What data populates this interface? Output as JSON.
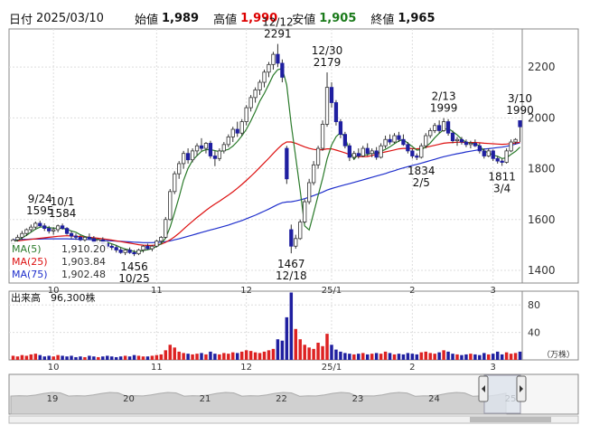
{
  "header": {
    "date_label": "日付",
    "date_value": "2025/03/10",
    "open_label": "始値",
    "open_value": "1,989",
    "high_label": "高値",
    "high_value": "1,990",
    "low_label": "安値",
    "low_value": "1,905",
    "close_label": "終値",
    "close_value": "1,965"
  },
  "colors": {
    "up": "#cc1111",
    "down": "#1f1fa0",
    "ma5": "#2a7a2a",
    "ma25": "#dd1111",
    "ma75": "#1f2fcc",
    "volume_up": "#dd2222",
    "volume_down": "#1f1fa0",
    "high_value": "#dd0000",
    "low_value": "#1a7a1a"
  },
  "legend": [
    {
      "label": "MA(5)",
      "value": "1,910.20",
      "color": "#2a7a2a"
    },
    {
      "label": "MA(25)",
      "value": "1,903.84",
      "color": "#dd1111"
    },
    {
      "label": "MA(75)",
      "value": "1,902.48",
      "color": "#1f2fcc"
    }
  ],
  "volume_panel": {
    "label": "出来高",
    "value": "96,300株",
    "unit": "（万株）",
    "yticks": [
      "80",
      "40"
    ]
  },
  "navigator": {
    "labels": [
      "19",
      "20",
      "21",
      "22",
      "23",
      "24",
      "25"
    ]
  },
  "chart_data": {
    "type": "candlestick",
    "title": "",
    "price_axis": {
      "ticks": [
        1400,
        1600,
        1800,
        2000,
        2200
      ],
      "range": [
        1350,
        2350
      ]
    },
    "volume_axis": {
      "ticks": [
        40,
        80
      ],
      "range": [
        0,
        100
      ],
      "unit": "万株"
    },
    "x_ticks": [
      {
        "label": "10",
        "index": 9
      },
      {
        "label": "11",
        "index": 32
      },
      {
        "label": "12",
        "index": 52
      },
      {
        "label": "25/1",
        "index": 71
      },
      {
        "label": "2",
        "index": 89
      },
      {
        "label": "3",
        "index": 107
      }
    ],
    "annotations": [
      {
        "text": "9/24",
        "sub": "1595",
        "index": 6,
        "price": 1595,
        "position": "above"
      },
      {
        "text": "10/1",
        "sub": "1584",
        "index": 11,
        "price": 1584,
        "position": "above"
      },
      {
        "text": "1456",
        "sub": "10/25",
        "index": 27,
        "price": 1456,
        "position": "below"
      },
      {
        "text": "12/12",
        "sub": "2291",
        "index": 59,
        "price": 2291,
        "position": "above"
      },
      {
        "text": "1467",
        "sub": "12/18",
        "index": 62,
        "price": 1467,
        "position": "below"
      },
      {
        "text": "12/30",
        "sub": "2179",
        "index": 70,
        "price": 2179,
        "position": "above"
      },
      {
        "text": "1834",
        "sub": "2/5",
        "index": 91,
        "price": 1834,
        "position": "below"
      },
      {
        "text": "2/13",
        "sub": "1999",
        "index": 96,
        "price": 1999,
        "position": "above"
      },
      {
        "text": "1811",
        "sub": "3/4",
        "index": 109,
        "price": 1811,
        "position": "below"
      },
      {
        "text": "3/10",
        "sub": "1990",
        "index": 113,
        "price": 1990,
        "position": "above"
      }
    ],
    "ohlc": [
      [
        1505,
        1525,
        1495,
        1520
      ],
      [
        1520,
        1540,
        1510,
        1530
      ],
      [
        1530,
        1555,
        1520,
        1545
      ],
      [
        1545,
        1565,
        1535,
        1560
      ],
      [
        1560,
        1580,
        1550,
        1570
      ],
      [
        1570,
        1592,
        1560,
        1585
      ],
      [
        1585,
        1595,
        1570,
        1575
      ],
      [
        1575,
        1585,
        1555,
        1565
      ],
      [
        1565,
        1575,
        1545,
        1555
      ],
      [
        1555,
        1570,
        1540,
        1560
      ],
      [
        1560,
        1580,
        1550,
        1575
      ],
      [
        1575,
        1584,
        1560,
        1565
      ],
      [
        1565,
        1570,
        1540,
        1545
      ],
      [
        1545,
        1555,
        1525,
        1535
      ],
      [
        1535,
        1545,
        1520,
        1530
      ],
      [
        1530,
        1540,
        1515,
        1520
      ],
      [
        1520,
        1535,
        1510,
        1530
      ],
      [
        1530,
        1545,
        1520,
        1525
      ],
      [
        1525,
        1535,
        1505,
        1510
      ],
      [
        1510,
        1525,
        1500,
        1520
      ],
      [
        1520,
        1530,
        1500,
        1505
      ],
      [
        1505,
        1515,
        1485,
        1495
      ],
      [
        1495,
        1505,
        1480,
        1490
      ],
      [
        1490,
        1500,
        1470,
        1480
      ],
      [
        1480,
        1490,
        1465,
        1470
      ],
      [
        1470,
        1485,
        1460,
        1480
      ],
      [
        1480,
        1490,
        1465,
        1470
      ],
      [
        1470,
        1480,
        1456,
        1465
      ],
      [
        1465,
        1485,
        1460,
        1480
      ],
      [
        1480,
        1500,
        1470,
        1495
      ],
      [
        1495,
        1505,
        1480,
        1485
      ],
      [
        1485,
        1500,
        1475,
        1495
      ],
      [
        1495,
        1520,
        1490,
        1515
      ],
      [
        1515,
        1535,
        1505,
        1530
      ],
      [
        1530,
        1610,
        1525,
        1600
      ],
      [
        1600,
        1720,
        1595,
        1710
      ],
      [
        1710,
        1790,
        1700,
        1780
      ],
      [
        1780,
        1830,
        1760,
        1820
      ],
      [
        1820,
        1870,
        1800,
        1860
      ],
      [
        1860,
        1880,
        1820,
        1835
      ],
      [
        1835,
        1880,
        1825,
        1870
      ],
      [
        1870,
        1900,
        1850,
        1890
      ],
      [
        1890,
        1920,
        1870,
        1880
      ],
      [
        1880,
        1905,
        1860,
        1900
      ],
      [
        1900,
        1910,
        1840,
        1850
      ],
      [
        1850,
        1870,
        1810,
        1840
      ],
      [
        1840,
        1880,
        1830,
        1870
      ],
      [
        1870,
        1905,
        1860,
        1895
      ],
      [
        1895,
        1935,
        1885,
        1925
      ],
      [
        1925,
        1965,
        1905,
        1955
      ],
      [
        1955,
        1985,
        1925,
        1940
      ],
      [
        1940,
        1995,
        1930,
        1985
      ],
      [
        1985,
        2050,
        1970,
        2040
      ],
      [
        2040,
        2090,
        2025,
        2080
      ],
      [
        2080,
        2120,
        2060,
        2110
      ],
      [
        2110,
        2150,
        2090,
        2140
      ],
      [
        2140,
        2190,
        2120,
        2180
      ],
      [
        2180,
        2220,
        2160,
        2210
      ],
      [
        2210,
        2260,
        2190,
        2250
      ],
      [
        2250,
        2291,
        2200,
        2215
      ],
      [
        2215,
        2230,
        2140,
        2160
      ],
      [
        1880,
        1890,
        1740,
        1760
      ],
      [
        1560,
        1580,
        1467,
        1495
      ],
      [
        1495,
        1540,
        1485,
        1525
      ],
      [
        1525,
        1600,
        1520,
        1590
      ],
      [
        1590,
        1680,
        1585,
        1670
      ],
      [
        1670,
        1760,
        1660,
        1745
      ],
      [
        1745,
        1830,
        1735,
        1815
      ],
      [
        1815,
        1890,
        1800,
        1880
      ],
      [
        1880,
        1990,
        1870,
        1975
      ],
      [
        1975,
        2179,
        1965,
        2120
      ],
      [
        2120,
        2140,
        2040,
        2060
      ],
      [
        2060,
        2070,
        1970,
        1985
      ],
      [
        1985,
        1995,
        1920,
        1935
      ],
      [
        1935,
        1945,
        1880,
        1890
      ],
      [
        1890,
        1900,
        1830,
        1845
      ],
      [
        1845,
        1870,
        1835,
        1860
      ],
      [
        1860,
        1880,
        1840,
        1850
      ],
      [
        1850,
        1890,
        1845,
        1880
      ],
      [
        1880,
        1900,
        1850,
        1860
      ],
      [
        1860,
        1880,
        1845,
        1870
      ],
      [
        1870,
        1885,
        1835,
        1845
      ],
      [
        1845,
        1900,
        1840,
        1890
      ],
      [
        1890,
        1930,
        1880,
        1915
      ],
      [
        1915,
        1935,
        1895,
        1905
      ],
      [
        1905,
        1940,
        1900,
        1930
      ],
      [
        1930,
        1945,
        1905,
        1915
      ],
      [
        1915,
        1935,
        1890,
        1895
      ],
      [
        1895,
        1905,
        1860,
        1870
      ],
      [
        1870,
        1880,
        1840,
        1850
      ],
      [
        1850,
        1860,
        1834,
        1845
      ],
      [
        1845,
        1900,
        1840,
        1890
      ],
      [
        1890,
        1940,
        1880,
        1930
      ],
      [
        1930,
        1960,
        1920,
        1950
      ],
      [
        1950,
        1980,
        1940,
        1970
      ],
      [
        1970,
        1990,
        1940,
        1950
      ],
      [
        1950,
        1999,
        1945,
        1985
      ],
      [
        1985,
        1995,
        1930,
        1940
      ],
      [
        1940,
        1950,
        1900,
        1910
      ],
      [
        1910,
        1925,
        1890,
        1915
      ],
      [
        1915,
        1925,
        1895,
        1905
      ],
      [
        1905,
        1915,
        1885,
        1895
      ],
      [
        1895,
        1910,
        1880,
        1900
      ],
      [
        1900,
        1915,
        1885,
        1890
      ],
      [
        1890,
        1900,
        1860,
        1870
      ],
      [
        1870,
        1880,
        1840,
        1850
      ],
      [
        1850,
        1880,
        1845,
        1870
      ],
      [
        1870,
        1875,
        1830,
        1840
      ],
      [
        1840,
        1850,
        1820,
        1830
      ],
      [
        1830,
        1840,
        1811,
        1825
      ],
      [
        1825,
        1880,
        1820,
        1870
      ],
      [
        1870,
        1915,
        1865,
        1905
      ],
      [
        1905,
        1920,
        1895,
        1915
      ],
      [
        1989,
        1990,
        1905,
        1965
      ]
    ],
    "volume": [
      6,
      5,
      7,
      6,
      8,
      9,
      7,
      5,
      6,
      5,
      7,
      6,
      5,
      6,
      4,
      5,
      4,
      6,
      5,
      4,
      5,
      6,
      5,
      4,
      5,
      6,
      5,
      7,
      6,
      5,
      5,
      6,
      7,
      8,
      14,
      22,
      18,
      12,
      10,
      9,
      8,
      9,
      10,
      8,
      12,
      9,
      8,
      10,
      9,
      11,
      10,
      12,
      14,
      13,
      11,
      10,
      12,
      14,
      16,
      30,
      28,
      62,
      98,
      45,
      30,
      22,
      18,
      16,
      25,
      20,
      38,
      22,
      15,
      12,
      10,
      9,
      8,
      9,
      10,
      8,
      9,
      10,
      9,
      12,
      10,
      8,
      9,
      8,
      10,
      9,
      8,
      11,
      12,
      10,
      9,
      11,
      14,
      12,
      9,
      8,
      7,
      8,
      9,
      8,
      7,
      10,
      8,
      9,
      12,
      8,
      11,
      9,
      10,
      12
    ],
    "ma5": [
      1510,
      1518,
      1528,
      1538,
      1550,
      1562,
      1570,
      1571,
      1568,
      1566,
      1566,
      1565,
      1562,
      1555,
      1550,
      1540,
      1533,
      1528,
      1523,
      1521,
      1516,
      1510,
      1504,
      1498,
      1490,
      1484,
      1480,
      1474,
      1473,
      1478,
      1481,
      1485,
      1494,
      1504,
      1527,
      1570,
      1627,
      1688,
      1754,
      1801,
      1833,
      1851,
      1868,
      1875,
      1875,
      1871,
      1867,
      1871,
      1876,
      1889,
      1907,
      1929,
      1955,
      1988,
      2025,
      2066,
      2096,
      2132,
      2168,
      2190,
      2194,
      2130,
      1974,
      1845,
      1715,
      1575,
      1559,
      1625,
      1695,
      1762,
      1838,
      1893,
      1926,
      1942,
      1925,
      1868,
      1837,
      1858,
      1853,
      1855,
      1862,
      1861,
      1868,
      1876,
      1886,
      1898,
      1909,
      1915,
      1900,
      1887,
      1873,
      1875,
      1886,
      1901,
      1922,
      1939,
      1954,
      1959,
      1946,
      1933,
      1916,
      1904,
      1900,
      1898,
      1890,
      1870,
      1862,
      1853,
      1849,
      1840,
      1843,
      1856,
      1868,
      1885
    ],
    "ma25": [
      1515,
      1516,
      1518,
      1520,
      1522,
      1524,
      1526,
      1528,
      1530,
      1532,
      1534,
      1535,
      1536,
      1535,
      1534,
      1533,
      1532,
      1530,
      1528,
      1526,
      1524,
      1522,
      1519,
      1516,
      1513,
      1510,
      1507,
      1504,
      1501,
      1499,
      1498,
      1498,
      1500,
      1503,
      1510,
      1520,
      1532,
      1546,
      1562,
      1578,
      1593,
      1608,
      1622,
      1636,
      1649,
      1661,
      1672,
      1684,
      1696,
      1709,
      1723,
      1738,
      1754,
      1770,
      1787,
      1805,
      1823,
      1841,
      1860,
      1878,
      1895,
      1905,
      1905,
      1900,
      1893,
      1886,
      1880,
      1876,
      1874,
      1875,
      1878,
      1878,
      1873,
      1868,
      1862,
      1856,
      1851,
      1848,
      1847,
      1848,
      1852,
      1857,
      1862,
      1866,
      1870,
      1874,
      1878,
      1880,
      1880,
      1879,
      1878,
      1880,
      1884,
      1888,
      1892,
      1896,
      1900,
      1902,
      1903,
      1904,
      1904,
      1903,
      1903,
      1903,
      1902,
      1900,
      1899,
      1898,
      1897,
      1896,
      1897,
      1899,
      1901,
      1904
    ],
    "ma75": [
      1520,
      1521,
      1522,
      1522,
      1523,
      1523,
      1523,
      1524,
      1524,
      1524,
      1524,
      1524,
      1524,
      1523,
      1523,
      1522,
      1522,
      1521,
      1520,
      1519,
      1518,
      1517,
      1516,
      1515,
      1514,
      1513,
      1512,
      1511,
      1510,
      1509,
      1509,
      1509,
      1510,
      1511,
      1513,
      1516,
      1520,
      1524,
      1529,
      1534,
      1539,
      1544,
      1549,
      1554,
      1559,
      1563,
      1568,
      1573,
      1578,
      1584,
      1590,
      1596,
      1603,
      1610,
      1617,
      1625,
      1633,
      1641,
      1650,
      1659,
      1666,
      1669,
      1670,
      1673,
      1677,
      1682,
      1688,
      1694,
      1701,
      1708,
      1716,
      1722,
      1727,
      1732,
      1737,
      1741,
      1746,
      1751,
      1756,
      1761,
      1766,
      1771,
      1776,
      1781,
      1787,
      1792,
      1798,
      1803,
      1808,
      1813,
      1817,
      1822,
      1827,
      1832,
      1837,
      1842,
      1847,
      1851,
      1855,
      1859,
      1862,
      1866,
      1869,
      1872,
      1875,
      1877,
      1879,
      1881,
      1883,
      1885,
      1888,
      1892,
      1897,
      1902
    ]
  }
}
